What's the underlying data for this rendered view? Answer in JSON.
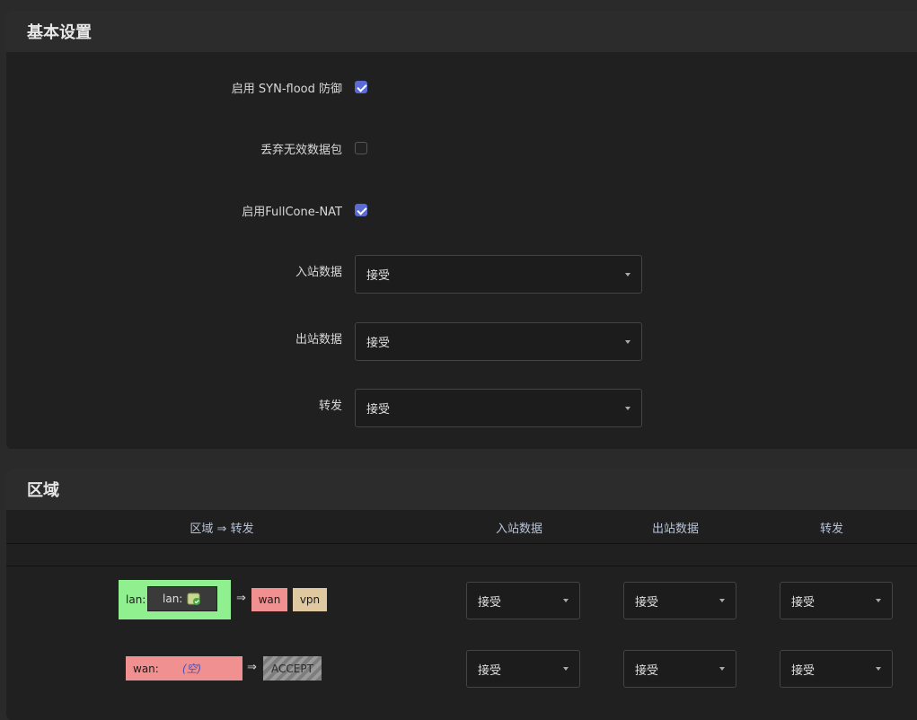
{
  "basic": {
    "title": "基本设置",
    "syn_flood_label": "启用 SYN-flood 防御",
    "syn_flood_checked": true,
    "drop_invalid_label": "丢弃无效数据包",
    "drop_invalid_checked": false,
    "fullcone_label": "启用FullCone-NAT",
    "fullcone_checked": true,
    "input_label": "入站数据",
    "input_value": "接受",
    "output_label": "出站数据",
    "output_value": "接受",
    "forward_label": "转发",
    "forward_value": "接受"
  },
  "zones": {
    "title": "区域",
    "headers": {
      "zone_forward": "区域 ⇒ 转发",
      "input": "入站数据",
      "output": "出站数据",
      "forward": "转发"
    },
    "rows": [
      {
        "zone_name": "lan:",
        "network": "lan:",
        "arrow": "⇒",
        "targets": [
          "wan",
          "vpn"
        ],
        "input": "接受",
        "output": "接受",
        "forward": "接受",
        "zone_color": "#90f090"
      },
      {
        "zone_name": "wan:",
        "network": "(空)",
        "arrow": "⇒",
        "targets": [
          "ACCEPT"
        ],
        "input": "接受",
        "output": "接受",
        "forward": "接受",
        "zone_color": "#f09090"
      }
    ]
  },
  "colors": {
    "accent": "#5b6bd6",
    "wan": "#f09090",
    "vpn": "#e0c8a0",
    "lan": "#90f090"
  }
}
